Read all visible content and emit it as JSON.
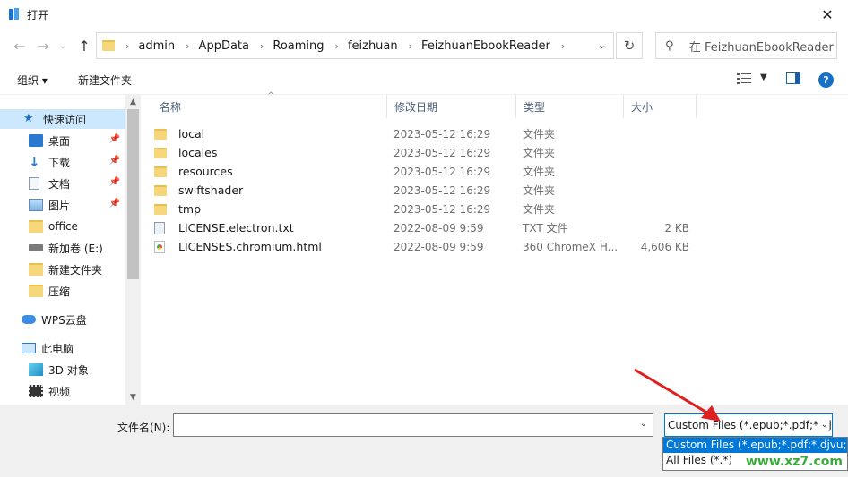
{
  "window": {
    "title": "打开",
    "close_glyph": "✕"
  },
  "address_bar": {
    "crumbs": [
      "admin",
      "AppData",
      "Roaming",
      "feizhuan",
      "FeizhuanEbookReader"
    ],
    "search_placeholder": "在 FeizhuanEbookReader 中搜索"
  },
  "toolbar": {
    "organize": "组织 ▾",
    "new_folder": "新建文件夹",
    "help": "?"
  },
  "sidebar": {
    "items": [
      {
        "label": "快速访问",
        "icon": "star-icon"
      },
      {
        "label": "桌面",
        "icon": "desktop-icon",
        "pinned": true
      },
      {
        "label": "下载",
        "icon": "download-icon",
        "pinned": true
      },
      {
        "label": "文档",
        "icon": "document-icon",
        "pinned": true
      },
      {
        "label": "图片",
        "icon": "picture-icon",
        "pinned": true
      },
      {
        "label": "office",
        "icon": "folder-icon"
      },
      {
        "label": "新加卷 (E:)",
        "icon": "drive-icon"
      },
      {
        "label": "新建文件夹",
        "icon": "folder-icon"
      },
      {
        "label": "压缩",
        "icon": "folder-icon"
      },
      {
        "label": "WPS云盘",
        "icon": "cloud-icon"
      },
      {
        "label": "此电脑",
        "icon": "computer-icon"
      },
      {
        "label": "3D 对象",
        "icon": "3d-objects-icon"
      },
      {
        "label": "视频",
        "icon": "video-icon"
      }
    ]
  },
  "columns": {
    "name": "名称",
    "date": "修改日期",
    "type": "类型",
    "size": "大小"
  },
  "files": [
    {
      "name": "local",
      "date": "2023-05-12 16:29",
      "type": "文件夹",
      "size": "",
      "icon": "folder-icon"
    },
    {
      "name": "locales",
      "date": "2023-05-12 16:29",
      "type": "文件夹",
      "size": "",
      "icon": "folder-icon"
    },
    {
      "name": "resources",
      "date": "2023-05-12 16:29",
      "type": "文件夹",
      "size": "",
      "icon": "folder-icon"
    },
    {
      "name": "swiftshader",
      "date": "2023-05-12 16:29",
      "type": "文件夹",
      "size": "",
      "icon": "folder-icon"
    },
    {
      "name": "tmp",
      "date": "2023-05-12 16:29",
      "type": "文件夹",
      "size": "",
      "icon": "folder-icon"
    },
    {
      "name": "LICENSE.electron.txt",
      "date": "2022-08-09 9:59",
      "type": "TXT 文件",
      "size": "2 KB",
      "icon": "text-file-icon"
    },
    {
      "name": "LICENSES.chromium.html",
      "date": "2022-08-09 9:59",
      "type": "360 ChromeX H...",
      "size": "4,606 KB",
      "icon": "html-file-icon"
    }
  ],
  "bottom": {
    "filename_label": "文件名(N):",
    "filename_value": "",
    "filter_selected": "Custom Files (*.epub;*.pdf;*.djvu;*.mobi)",
    "filter_options": [
      "Custom Files (*.epub;*.pdf;*.djvu;*.m",
      "All Files (*.*)"
    ]
  },
  "watermark": "www.xz7.com",
  "colors": {
    "accent": "#0078d7",
    "selection": "#cce8ff",
    "annotation_arrow": "#e02020"
  }
}
